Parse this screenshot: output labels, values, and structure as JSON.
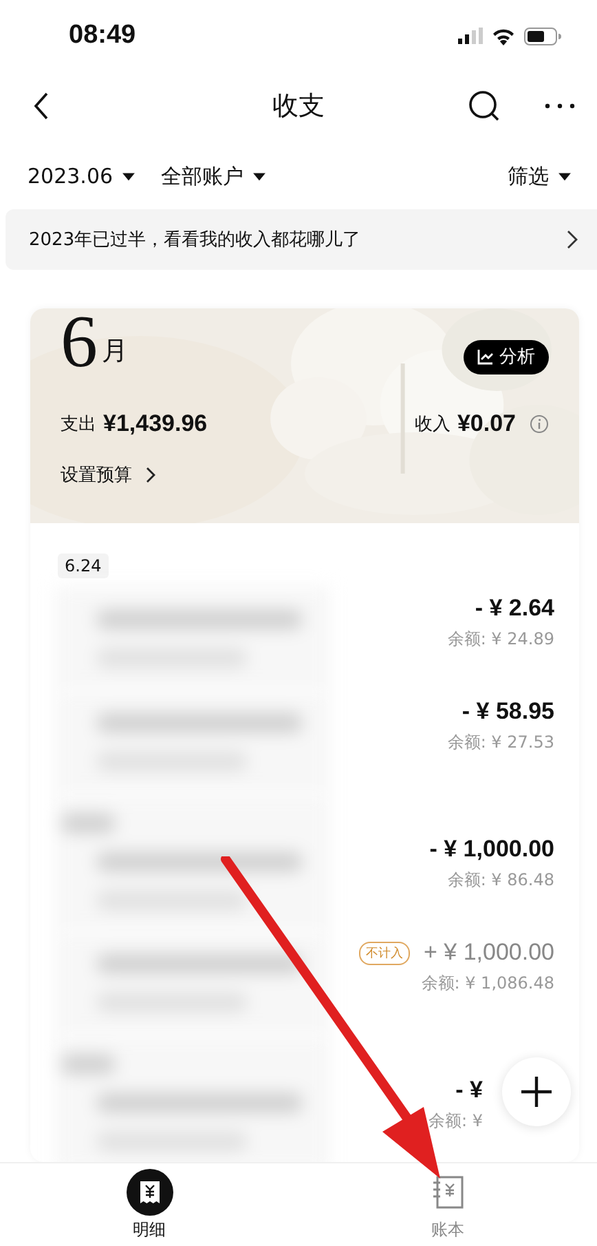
{
  "status_bar": {
    "time": "08:49"
  },
  "nav": {
    "title": "收支"
  },
  "filters": {
    "month": "2023.06",
    "account": "全部账户",
    "filter": "筛选"
  },
  "banner": {
    "text": "2023年已过半，看看我的收入都花哪儿了"
  },
  "summary": {
    "month_number": "6",
    "month_unit": "月",
    "analysis_button": "分析",
    "expense_label": "支出",
    "expense": "¥1,439.96",
    "income_label": "收入",
    "income": "¥0.07",
    "budget_link": "设置预算"
  },
  "day_chip": "6.24",
  "transactions": [
    {
      "amount": "- ¥ 2.64",
      "balance": "余额: ¥ 24.89",
      "excluded": false,
      "new_day": false
    },
    {
      "amount": "- ¥ 58.95",
      "balance": "余额: ¥ 27.53",
      "excluded": false,
      "new_day": false
    },
    {
      "amount": "- ¥ 1,000.00",
      "balance": "余额: ¥ 86.48",
      "excluded": false,
      "new_day": true
    },
    {
      "amount": "+ ¥ 1,000.00",
      "balance": "余额: ¥ 1,086.48",
      "excluded": true,
      "tag": "不计入",
      "new_day": false
    },
    {
      "amount": "- ¥",
      "balance": "余额: ¥",
      "excluded": false,
      "new_day": true
    }
  ],
  "tabs": [
    {
      "label": "明细",
      "selected": true
    },
    {
      "label": "账本",
      "selected": false
    }
  ]
}
